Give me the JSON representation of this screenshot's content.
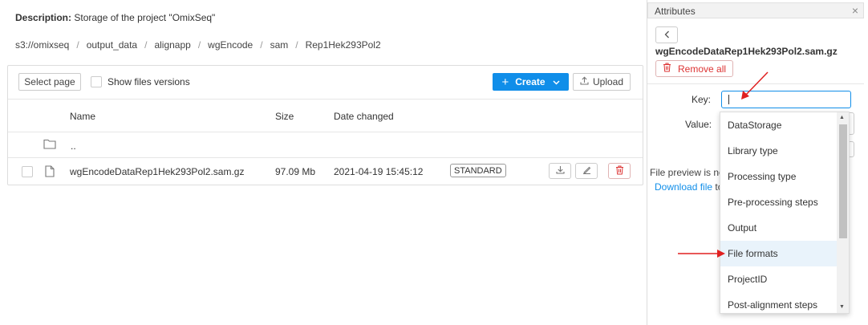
{
  "description": {
    "label": "Description:",
    "text": "Storage of the project \"OmixSeq\""
  },
  "breadcrumb": [
    "s3://omixseq",
    "output_data",
    "alignapp",
    "wgEncode",
    "sam",
    "Rep1Hek293Pol2"
  ],
  "breadcrumb_separator": "/",
  "toolbar": {
    "select_page": "Select page",
    "show_versions": "Show files versions",
    "create": "Create",
    "upload": "Upload"
  },
  "table": {
    "columns": [
      "Name",
      "Size",
      "Date changed"
    ],
    "parent_row": {
      "name": ".."
    },
    "rows": [
      {
        "name": "wgEncodeDataRep1Hek293Pol2.sam.gz",
        "size": "97.09 Mb",
        "date": "2021-04-19 15:45:12",
        "storage_class": "STANDARD"
      }
    ]
  },
  "attributes": {
    "title": "Attributes",
    "close": "×",
    "file_name": "wgEncodeDataRep1Hek293Pol2.sam.gz",
    "remove_all": "Remove all",
    "key_label": "Key:",
    "value_label": "Value:",
    "key_value": "",
    "preview_text": "File preview is no",
    "download_link": "Download file",
    "download_suffix": " to"
  },
  "dropdown": {
    "items": [
      "DataStorage",
      "Library type",
      "Processing type",
      "Pre-processing steps",
      "Output",
      "File formats",
      "ProjectID",
      "Post-alignment steps"
    ],
    "highlighted": "File formats"
  },
  "colors": {
    "primary": "#108ee9",
    "danger": "#dd3333",
    "arrow": "#e02020"
  }
}
